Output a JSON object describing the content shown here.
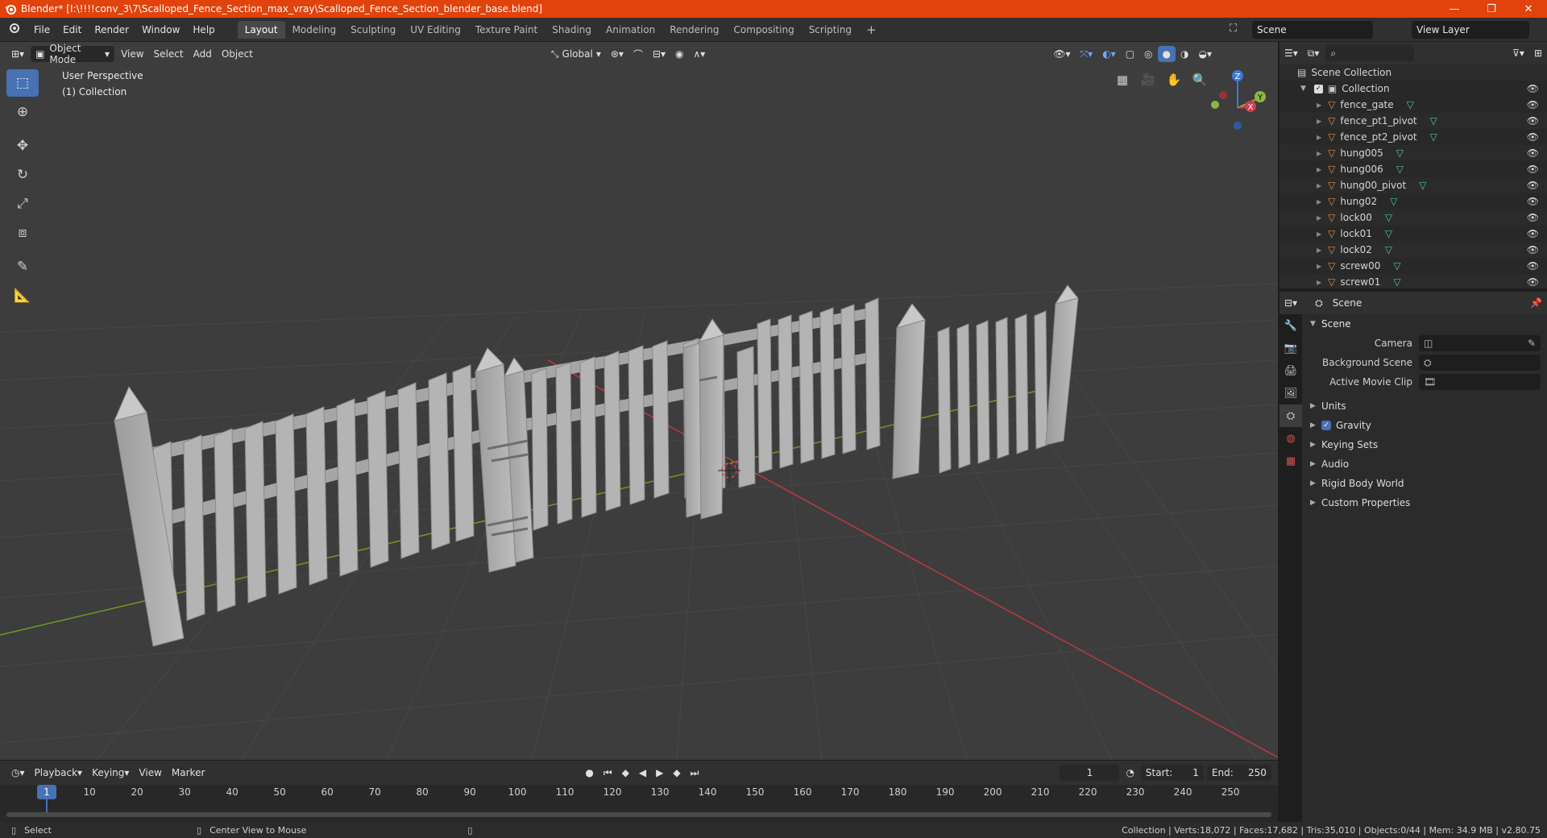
{
  "window": {
    "title": "Blender* [I:\\!!!!conv_3\\7\\Scalloped_Fence_Section_max_vray\\Scalloped_Fence_Section_blender_base.blend]",
    "minimize": "—",
    "maximize": "❐",
    "close": "✕"
  },
  "menu": [
    "File",
    "Edit",
    "Render",
    "Window",
    "Help"
  ],
  "workspaces": [
    "Layout",
    "Modeling",
    "Sculpting",
    "UV Editing",
    "Texture Paint",
    "Shading",
    "Animation",
    "Rendering",
    "Compositing",
    "Scripting"
  ],
  "active_workspace": "Layout",
  "add_workspace": "+",
  "scene_name": "Scene",
  "view_layer": "View Layer",
  "viewport_header": {
    "mode": "Object Mode",
    "menus": [
      "View",
      "Select",
      "Add",
      "Object"
    ],
    "transform_orientation": "Global"
  },
  "viewport_info": {
    "perspective": "User Perspective",
    "collection": "(1) Collection"
  },
  "gizmo": {
    "z": "Z",
    "y": "Y",
    "x": "X"
  },
  "timeline": {
    "menus": [
      "Playback",
      "Keying",
      "View",
      "Marker"
    ],
    "current_frame": "1",
    "start_label": "Start:",
    "start": "1",
    "end_label": "End:",
    "end": "250",
    "ticks": [
      "1",
      "10",
      "20",
      "30",
      "40",
      "50",
      "60",
      "70",
      "80",
      "90",
      "100",
      "110",
      "120",
      "130",
      "140",
      "150",
      "160",
      "170",
      "180",
      "190",
      "200",
      "210",
      "220",
      "230",
      "240",
      "250"
    ]
  },
  "statusbar": {
    "select": "Select",
    "center_view": "Center View to Mouse",
    "stats": "Collection | Verts:18,072 | Faces:17,682 | Tris:35,010 | Objects:0/44 | Mem: 34.9 MB | v2.80.75"
  },
  "outliner": {
    "root": "Scene Collection",
    "collection": "Collection",
    "items": [
      "fence_gate",
      "fence_pt1_pivot",
      "fence_pt2_pivot",
      "hung005",
      "hung006",
      "hung00_pivot",
      "hung02",
      "lock00",
      "lock01",
      "lock02",
      "screw00",
      "screw01"
    ]
  },
  "properties": {
    "header": "Scene",
    "panel": "Scene",
    "camera_label": "Camera",
    "background_label": "Background Scene",
    "movieclip_label": "Active Movie Clip",
    "subpanels": [
      "Units",
      "Gravity",
      "Keying Sets",
      "Audio",
      "Rigid Body World",
      "Custom Properties"
    ]
  },
  "colors": {
    "titlebar": "#e2420c",
    "accent": "#4772b3",
    "viewport_bg": "#3d3d3d",
    "x_axis": "#c2383f",
    "y_axis": "#6f9a1f",
    "object_icon": "#e88f3d",
    "mesh_icon": "#4ec7a3"
  }
}
